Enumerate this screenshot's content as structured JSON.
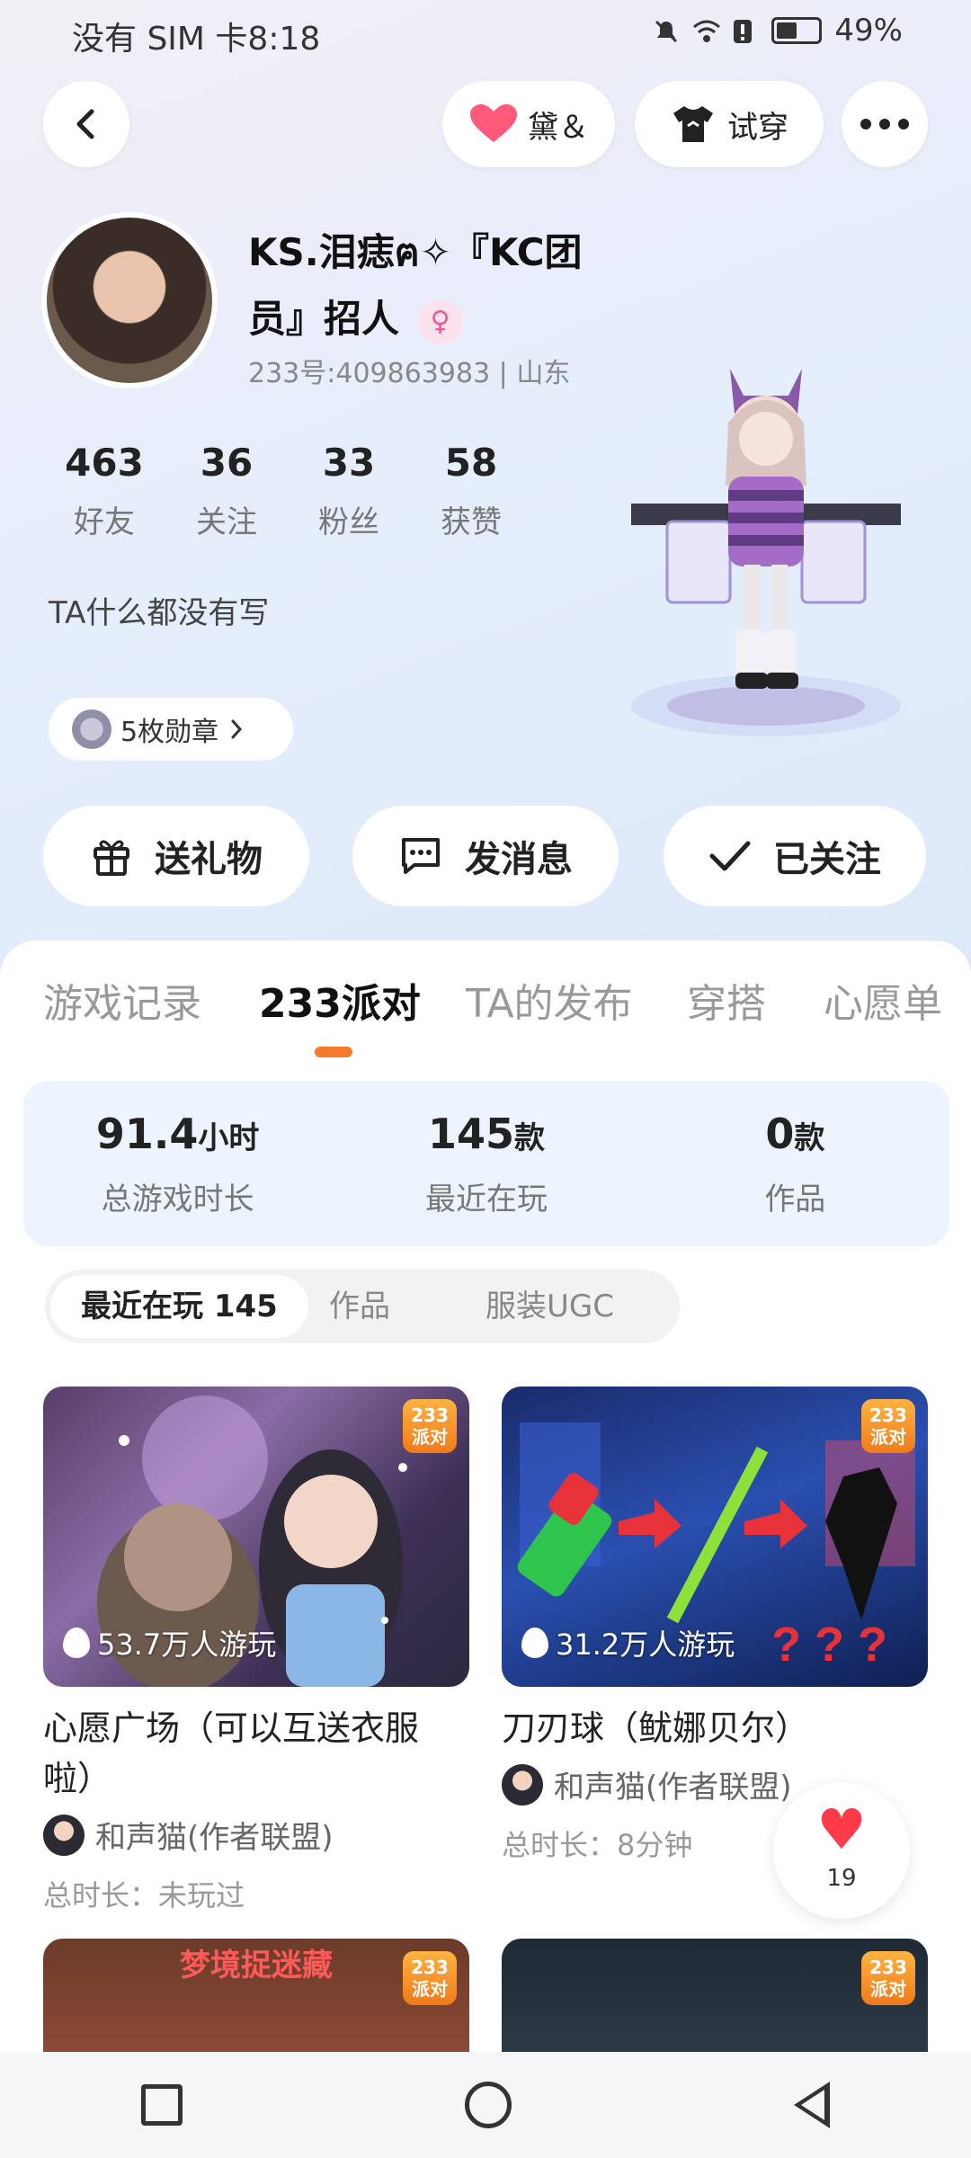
{
  "status_bar": {
    "left_text": "没有 SIM 卡8:18",
    "battery": "49%"
  },
  "header": {
    "heart_label": "黛＆",
    "tryon_label": "试穿"
  },
  "profile": {
    "name": "KS.泪痣ฅ✧『KC团员』招人",
    "uid_region": "233号:409863983 | 山东",
    "stats": [
      {
        "value": "463",
        "label": "好友"
      },
      {
        "value": "36",
        "label": "关注"
      },
      {
        "value": "33",
        "label": "粉丝"
      },
      {
        "value": "58",
        "label": "获赞"
      }
    ],
    "bio": "TA什么都没有写",
    "medal_label": "5枚勋章"
  },
  "actions": {
    "gift": "送礼物",
    "message": "发消息",
    "follow": "已关注"
  },
  "tabs": [
    "游戏记录",
    "233派对",
    "TA的发布",
    "穿搭",
    "心愿单"
  ],
  "summary": [
    {
      "value": "91.4",
      "unit": "小时",
      "label": "总游戏时长"
    },
    {
      "value": "145",
      "unit": "款",
      "label": "最近在玩"
    },
    {
      "value": "0",
      "unit": "款",
      "label": "作品"
    }
  ],
  "subtabs": [
    "最近在玩 145",
    "作品",
    "服装UGC"
  ],
  "cards": [
    {
      "plays": "53.7万人游玩",
      "title": "心愿广场（可以互送衣服啦）",
      "author": "和声猫(作者联盟)",
      "time": "总时长：未玩过",
      "badge": "233派对"
    },
    {
      "plays": "31.2万人游玩",
      "title": "刀刃球（鱿娜贝尔）",
      "author": "和声猫(作者联盟)",
      "time": "总时长：8分钟",
      "badge": "233派对"
    }
  ],
  "bottom_cards": [
    {
      "banner": "梦境捉迷藏",
      "badge": "233派对"
    },
    {
      "badge": "233派对"
    }
  ],
  "like_float": {
    "count": "19"
  },
  "colors": {
    "accent": "#f77a2a",
    "heart": "#ff3b4a"
  }
}
